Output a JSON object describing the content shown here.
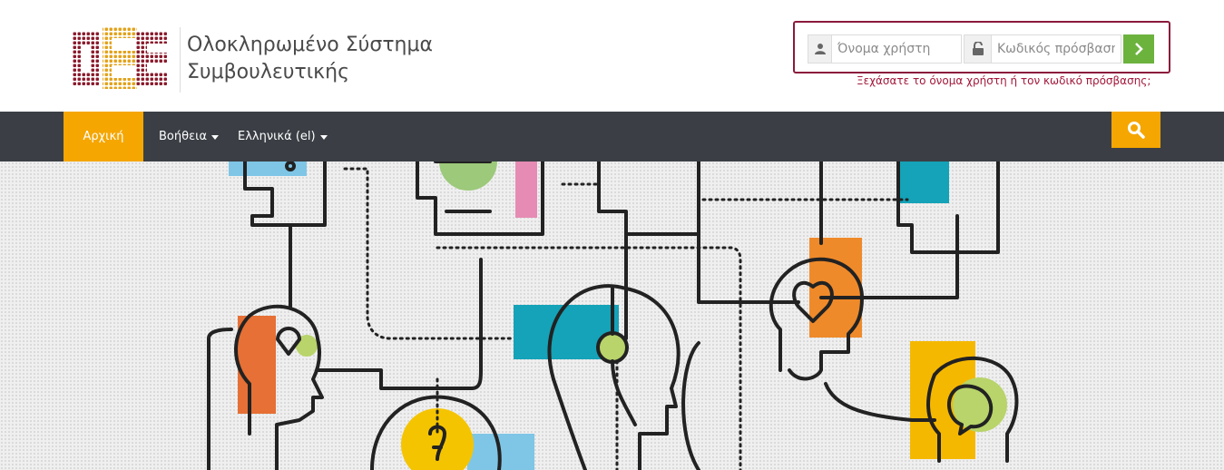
{
  "header": {
    "site_title_line1": "Ολοκληρωμένο Σύστημα",
    "site_title_line2": "Συμβουλευτικής",
    "logo_colors": {
      "dark": "#8a1a2c",
      "accent": "#e3a21a"
    }
  },
  "login": {
    "username_placeholder": "Όνομα χρήστη",
    "password_placeholder": "Κωδικός πρόσβασης",
    "forgot_text": "Ξεχάσατε το όνομα χρήστη ή τον κωδικό πρόσβασης;",
    "user_icon": "user-icon",
    "lock_icon": "unlock-icon",
    "submit_icon": "chevron-right-icon",
    "border_color": "#8b1a3c",
    "submit_color": "#6cb33e"
  },
  "nav": {
    "home": "Αρχική",
    "help": "Βοήθεια",
    "language": "Ελληνικά (el)",
    "search_icon": "search-icon",
    "bar_color": "#3b3f45",
    "accent_color": "#f5a600"
  },
  "hero": {
    "illustration": "heads-network-illustration"
  }
}
